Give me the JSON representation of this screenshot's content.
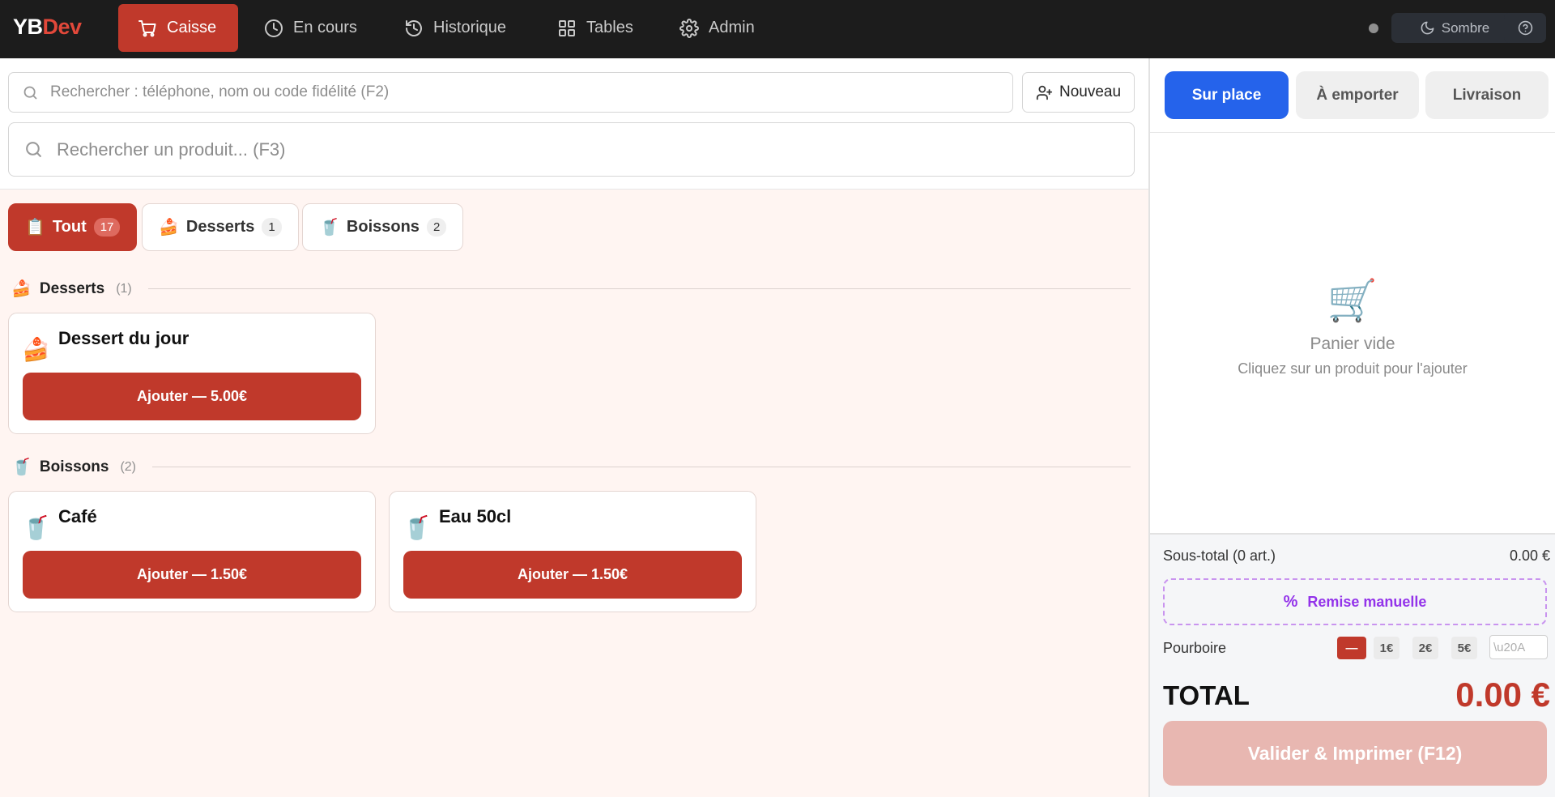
{
  "brand": {
    "part1": "YB",
    "part2": "Dev"
  },
  "nav": [
    {
      "label": "Caisse",
      "icon": "cart-icon",
      "active": true
    },
    {
      "label": "En cours",
      "icon": "clock-icon"
    },
    {
      "label": "Historique",
      "icon": "history-icon"
    },
    {
      "label": "Tables",
      "icon": "grid-icon"
    },
    {
      "label": "Admin",
      "icon": "gear-icon"
    }
  ],
  "header": {
    "theme_label": "Sombre"
  },
  "customer_search": {
    "placeholder": "Rechercher : téléphone, nom ou code fidélité (F2)",
    "new_label": "Nouveau"
  },
  "product_search": {
    "placeholder": "Rechercher un produit... (F3)"
  },
  "tabs": [
    {
      "emoji": "📋",
      "label": "Tout",
      "count": "17",
      "active": true
    },
    {
      "emoji": "🍰",
      "label": "Desserts",
      "count": "1"
    },
    {
      "emoji": "🥤",
      "label": "Boissons",
      "count": "2"
    }
  ],
  "sections": [
    {
      "emoji": "🍰",
      "title": "Desserts",
      "count": "(1)",
      "products": [
        {
          "emoji": "🍰",
          "name": "Dessert du jour",
          "button": "Ajouter — 5.00€"
        }
      ]
    },
    {
      "emoji": "🥤",
      "title": "Boissons",
      "count": "(2)",
      "products": [
        {
          "emoji": "🥤",
          "name": "Café",
          "button": "Ajouter — 1.50€"
        },
        {
          "emoji": "🥤",
          "name": "Eau 50cl",
          "button": "Ajouter — 1.50€"
        }
      ]
    }
  ],
  "order_modes": [
    {
      "label": "Sur place",
      "active": true
    },
    {
      "label": "À emporter"
    },
    {
      "label": "Livraison"
    }
  ],
  "cart": {
    "empty_title": "Panier vide",
    "empty_hint": "Cliquez sur un produit pour l'ajouter"
  },
  "summary": {
    "subtotal_label": "Sous-total (0 art.)",
    "subtotal_value": "0.00 €",
    "discount_label": "Remise manuelle",
    "tip_label": "Pourboire",
    "tip_options": [
      "—",
      "1€",
      "2€",
      "5€"
    ],
    "tip_placeholder": "\\u20A",
    "total_label": "TOTAL",
    "total_value": "0.00 €",
    "validate_label": "Valider & Imprimer (F12)"
  },
  "colors": {
    "accent": "#c0392b",
    "blue": "#2563eb",
    "purple": "#9333ea",
    "topbar": "#1c1c1c"
  }
}
